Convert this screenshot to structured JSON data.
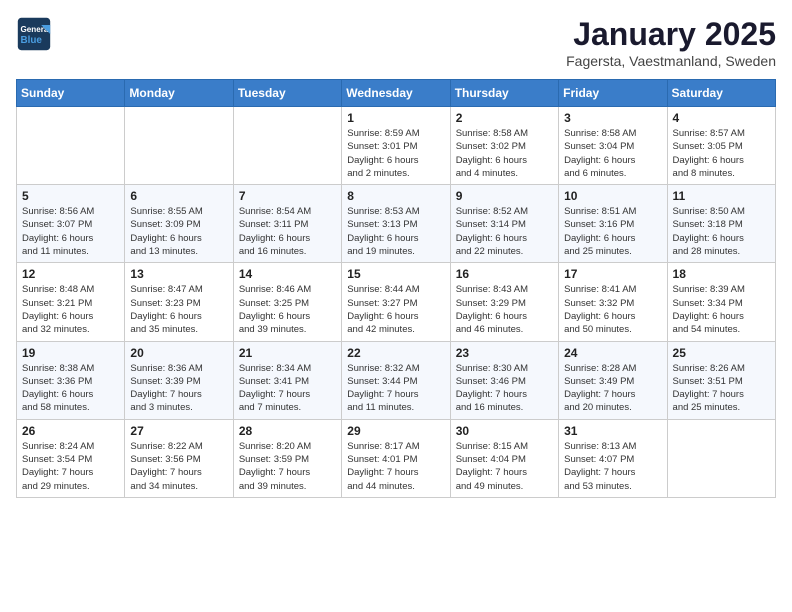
{
  "header": {
    "logo_line1": "General",
    "logo_line2": "Blue",
    "month_title": "January 2025",
    "subtitle": "Fagersta, Vaestmanland, Sweden"
  },
  "weekdays": [
    "Sunday",
    "Monday",
    "Tuesday",
    "Wednesday",
    "Thursday",
    "Friday",
    "Saturday"
  ],
  "weeks": [
    [
      {
        "day": "",
        "info": ""
      },
      {
        "day": "",
        "info": ""
      },
      {
        "day": "",
        "info": ""
      },
      {
        "day": "1",
        "info": "Sunrise: 8:59 AM\nSunset: 3:01 PM\nDaylight: 6 hours\nand 2 minutes."
      },
      {
        "day": "2",
        "info": "Sunrise: 8:58 AM\nSunset: 3:02 PM\nDaylight: 6 hours\nand 4 minutes."
      },
      {
        "day": "3",
        "info": "Sunrise: 8:58 AM\nSunset: 3:04 PM\nDaylight: 6 hours\nand 6 minutes."
      },
      {
        "day": "4",
        "info": "Sunrise: 8:57 AM\nSunset: 3:05 PM\nDaylight: 6 hours\nand 8 minutes."
      }
    ],
    [
      {
        "day": "5",
        "info": "Sunrise: 8:56 AM\nSunset: 3:07 PM\nDaylight: 6 hours\nand 11 minutes."
      },
      {
        "day": "6",
        "info": "Sunrise: 8:55 AM\nSunset: 3:09 PM\nDaylight: 6 hours\nand 13 minutes."
      },
      {
        "day": "7",
        "info": "Sunrise: 8:54 AM\nSunset: 3:11 PM\nDaylight: 6 hours\nand 16 minutes."
      },
      {
        "day": "8",
        "info": "Sunrise: 8:53 AM\nSunset: 3:13 PM\nDaylight: 6 hours\nand 19 minutes."
      },
      {
        "day": "9",
        "info": "Sunrise: 8:52 AM\nSunset: 3:14 PM\nDaylight: 6 hours\nand 22 minutes."
      },
      {
        "day": "10",
        "info": "Sunrise: 8:51 AM\nSunset: 3:16 PM\nDaylight: 6 hours\nand 25 minutes."
      },
      {
        "day": "11",
        "info": "Sunrise: 8:50 AM\nSunset: 3:18 PM\nDaylight: 6 hours\nand 28 minutes."
      }
    ],
    [
      {
        "day": "12",
        "info": "Sunrise: 8:48 AM\nSunset: 3:21 PM\nDaylight: 6 hours\nand 32 minutes."
      },
      {
        "day": "13",
        "info": "Sunrise: 8:47 AM\nSunset: 3:23 PM\nDaylight: 6 hours\nand 35 minutes."
      },
      {
        "day": "14",
        "info": "Sunrise: 8:46 AM\nSunset: 3:25 PM\nDaylight: 6 hours\nand 39 minutes."
      },
      {
        "day": "15",
        "info": "Sunrise: 8:44 AM\nSunset: 3:27 PM\nDaylight: 6 hours\nand 42 minutes."
      },
      {
        "day": "16",
        "info": "Sunrise: 8:43 AM\nSunset: 3:29 PM\nDaylight: 6 hours\nand 46 minutes."
      },
      {
        "day": "17",
        "info": "Sunrise: 8:41 AM\nSunset: 3:32 PM\nDaylight: 6 hours\nand 50 minutes."
      },
      {
        "day": "18",
        "info": "Sunrise: 8:39 AM\nSunset: 3:34 PM\nDaylight: 6 hours\nand 54 minutes."
      }
    ],
    [
      {
        "day": "19",
        "info": "Sunrise: 8:38 AM\nSunset: 3:36 PM\nDaylight: 6 hours\nand 58 minutes."
      },
      {
        "day": "20",
        "info": "Sunrise: 8:36 AM\nSunset: 3:39 PM\nDaylight: 7 hours\nand 3 minutes."
      },
      {
        "day": "21",
        "info": "Sunrise: 8:34 AM\nSunset: 3:41 PM\nDaylight: 7 hours\nand 7 minutes."
      },
      {
        "day": "22",
        "info": "Sunrise: 8:32 AM\nSunset: 3:44 PM\nDaylight: 7 hours\nand 11 minutes."
      },
      {
        "day": "23",
        "info": "Sunrise: 8:30 AM\nSunset: 3:46 PM\nDaylight: 7 hours\nand 16 minutes."
      },
      {
        "day": "24",
        "info": "Sunrise: 8:28 AM\nSunset: 3:49 PM\nDaylight: 7 hours\nand 20 minutes."
      },
      {
        "day": "25",
        "info": "Sunrise: 8:26 AM\nSunset: 3:51 PM\nDaylight: 7 hours\nand 25 minutes."
      }
    ],
    [
      {
        "day": "26",
        "info": "Sunrise: 8:24 AM\nSunset: 3:54 PM\nDaylight: 7 hours\nand 29 minutes."
      },
      {
        "day": "27",
        "info": "Sunrise: 8:22 AM\nSunset: 3:56 PM\nDaylight: 7 hours\nand 34 minutes."
      },
      {
        "day": "28",
        "info": "Sunrise: 8:20 AM\nSunset: 3:59 PM\nDaylight: 7 hours\nand 39 minutes."
      },
      {
        "day": "29",
        "info": "Sunrise: 8:17 AM\nSunset: 4:01 PM\nDaylight: 7 hours\nand 44 minutes."
      },
      {
        "day": "30",
        "info": "Sunrise: 8:15 AM\nSunset: 4:04 PM\nDaylight: 7 hours\nand 49 minutes."
      },
      {
        "day": "31",
        "info": "Sunrise: 8:13 AM\nSunset: 4:07 PM\nDaylight: 7 hours\nand 53 minutes."
      },
      {
        "day": "",
        "info": ""
      }
    ]
  ]
}
